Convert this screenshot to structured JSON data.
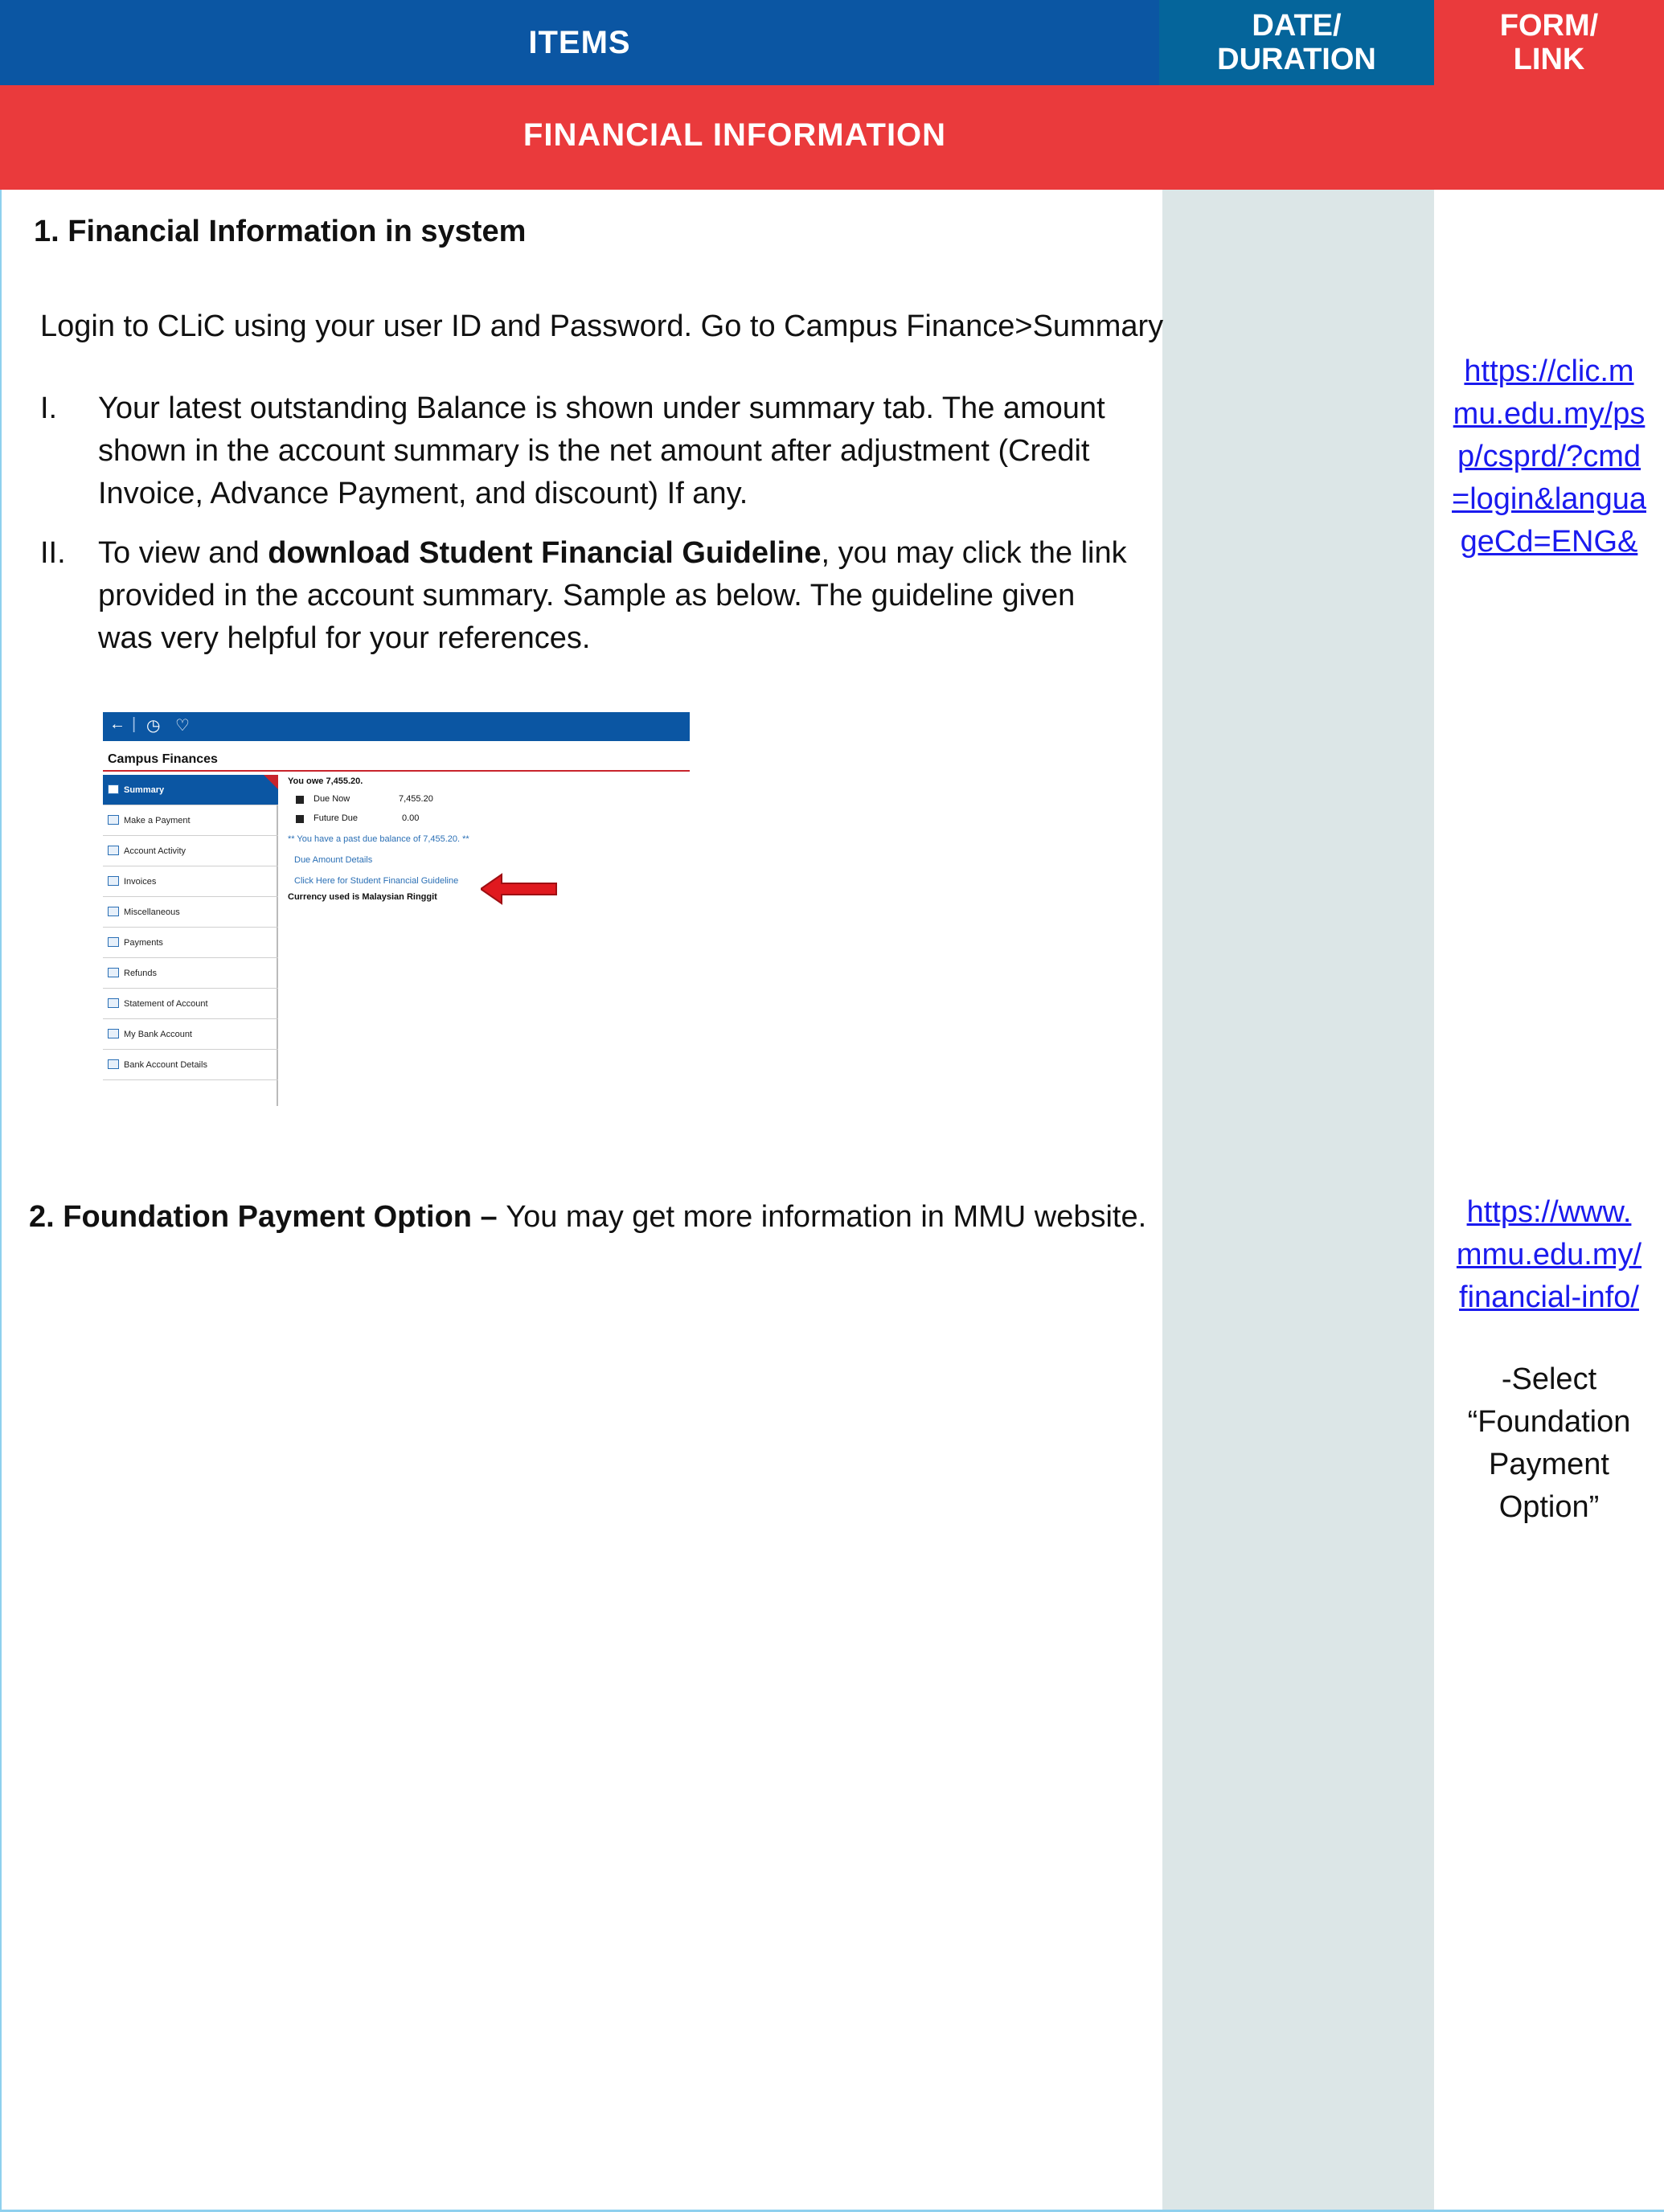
{
  "header": {
    "items": "ITEMS",
    "date_line1": "DATE/",
    "date_line2": "DURATION",
    "form_line1": "FORM/",
    "form_line2": "LINK"
  },
  "section": {
    "title": "FINANCIAL INFORMATION"
  },
  "item1": {
    "heading": "1. Financial Information in system",
    "login": "Login to CLiC using your user ID and Password. Go to Campus Finance>Summary",
    "points": [
      {
        "num": "I.",
        "lines": [
          "Your latest outstanding Balance is shown under summary tab. The amount",
          "shown in the account summary is the net amount after adjustment (Credit",
          "Invoice, Advance Payment, and discount) If any."
        ]
      },
      {
        "num": "II.",
        "pre": "To view and ",
        "bold": "download Student Financial Guideline",
        "post": ", you may click the link",
        "lines": [
          "provided in the account summary. Sample as below. The guideline given",
          "was very helpful for your references."
        ]
      }
    ],
    "link_lines": [
      "https://clic.m",
      "mu.edu.my/ps",
      "p/csprd/?cmd",
      "=login&langua",
      "geCd=ENG&"
    ]
  },
  "screenshot": {
    "bar_icons": [
      "←",
      "|",
      "◷",
      "♡"
    ],
    "title": "Campus Finances",
    "nav": [
      "Summary",
      "Make a Payment",
      "Account Activity",
      "Invoices",
      "Miscellaneous",
      "Payments",
      "Refunds",
      "Statement of Account",
      "My Bank Account",
      "Bank Account Details"
    ],
    "owe": "You owe 7,455.20.",
    "due_now_label": "Due Now",
    "due_now_value": "7,455.20",
    "future_due_label": "Future Due",
    "future_due_value": "0.00",
    "past_due": "** You have a past due balance of 7,455.20. **",
    "due_details": "Due Amount Details",
    "guideline_link": "Click Here for Student Financial Guideline",
    "currency": "Currency used is Malaysian Ringgit",
    "arrow_color": "#e0191f"
  },
  "item2": {
    "heading_bold": "2. Foundation Payment Option – ",
    "heading_rest": "You may get more information in MMU website.",
    "link_lines": [
      "https://www.",
      "mmu.edu.my/",
      "financial-info/"
    ],
    "note_lines": [
      "-Select",
      "“Foundation",
      "Payment",
      "Option”"
    ]
  },
  "colors": {
    "header_blue": "#0b56a3",
    "header_teal": "#05659b",
    "header_red": "#ea3a3c",
    "date_column": "#dce6e7",
    "link": "#1a1aee"
  }
}
